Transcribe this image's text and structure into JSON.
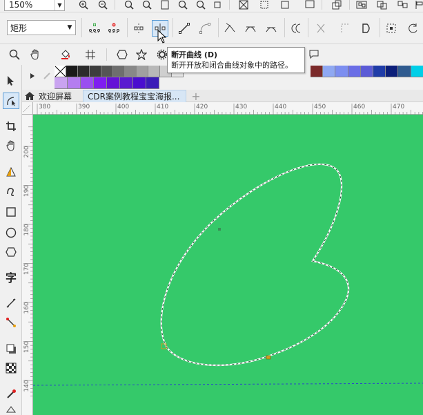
{
  "toolbar_top": {
    "zoom_value": "150%"
  },
  "property_bar": {
    "shape_select_value": "矩形"
  },
  "tooltip": {
    "title": "断开曲线 (D)",
    "description": "断开开放和闭合曲线对象中的路径。"
  },
  "palette": {
    "row1": [
      "#ffffff",
      "#1a1a1a",
      "#2b2b2b",
      "#3d3d3d",
      "#555555",
      "#6e6e6e",
      "#888888",
      "#a0a0a0",
      "#b8b8b8",
      "#cfcfcf",
      "#e4e4e4"
    ],
    "row1_right": [
      "#7b2a2a",
      "#8fa8f2",
      "#7c8ef0",
      "#6a6ee6",
      "#5b5bd6",
      "#1f3ca8",
      "#0c1f7a",
      "#2f5b8f",
      "#00cfe8"
    ],
    "row2": [
      "#c9a3f0",
      "#b47df0",
      "#9a4ff0",
      "#7f1ef0",
      "#6512d6",
      "#5a1ad0",
      "#4a0ecf",
      "#3b1cb8"
    ]
  },
  "tabs": {
    "welcome": "欢迎屏幕",
    "document": "CDR案例教程宝宝海报...",
    "add": "+"
  },
  "ruler": {
    "h_labels": [
      "380",
      "390",
      "400",
      "410",
      "420",
      "430",
      "440",
      "450",
      "460",
      "470"
    ],
    "v_labels": [
      "200",
      "190",
      "180",
      "170",
      "160",
      "150",
      "140"
    ]
  },
  "colors": {
    "canvas": "#35c96a",
    "accent_select": "#5b9bd5"
  }
}
